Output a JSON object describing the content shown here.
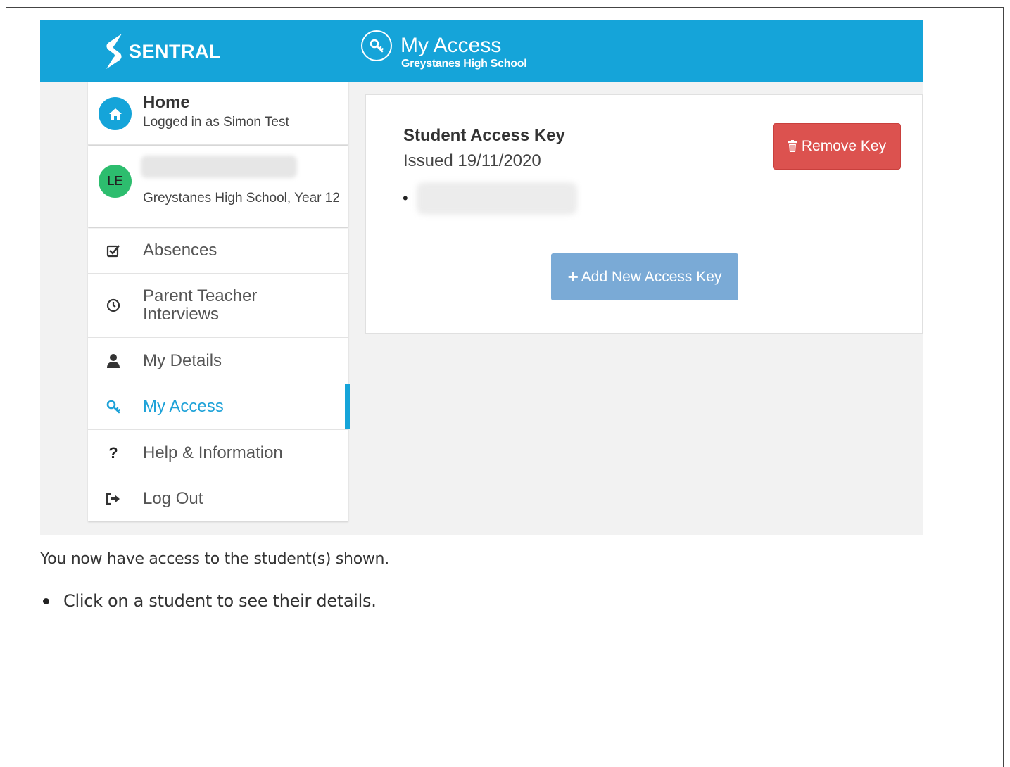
{
  "header": {
    "brand": "SENTRAL",
    "title": "My Access",
    "subtitle": "Greystanes High School",
    "icon": "key-icon"
  },
  "sidebar": {
    "home": {
      "title": "Home",
      "subtitle": "Logged in as Simon Test",
      "icon": "home-icon"
    },
    "student": {
      "initials": "LE",
      "school": "Greystanes High School, Year 12"
    },
    "items": [
      {
        "label": "Absences",
        "icon": "checkbox-icon"
      },
      {
        "label": "Parent Teacher Interviews",
        "icon": "clock-icon"
      },
      {
        "label": "My Details",
        "icon": "user-icon"
      },
      {
        "label": "My Access",
        "icon": "key-icon",
        "active": true
      },
      {
        "label": "Help & Information",
        "icon": "question-icon"
      },
      {
        "label": "Log Out",
        "icon": "logout-icon"
      }
    ]
  },
  "panel": {
    "title": "Student Access Key",
    "issued": "Issued 19/11/2020",
    "remove_label": "Remove Key",
    "add_label": "Add New Access Key"
  },
  "note": {
    "text": "You now have access to the student(s) shown.",
    "bullet": "Click on a student to see their details."
  },
  "colors": {
    "brand_blue": "#15a4d9",
    "danger": "#dc524f",
    "primary_light": "#7aaad6",
    "avatar_green": "#2dbd6e"
  }
}
